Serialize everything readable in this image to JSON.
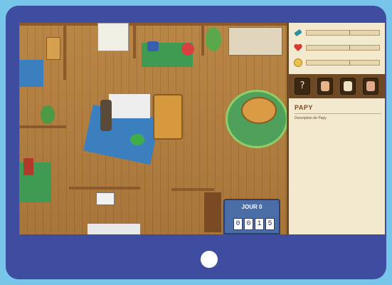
{
  "stats": [
    {
      "icon": "bandage-icon",
      "level": 0.0
    },
    {
      "icon": "heart-icon",
      "level": 0.0
    },
    {
      "icon": "coin-icon",
      "level": 0.0
    }
  ],
  "tabs": [
    {
      "name": "tab-help",
      "label": "?"
    },
    {
      "name": "tab-character-papy",
      "label": ""
    },
    {
      "name": "tab-item-1",
      "label": ""
    },
    {
      "name": "tab-item-2",
      "label": ""
    }
  ],
  "info": {
    "name": "PAPY",
    "description": "Description de Papy"
  },
  "day": {
    "label": "JOUR 0",
    "digits": [
      "0",
      "0",
      "1",
      "5"
    ]
  },
  "colors": {
    "background": "#78c5ea",
    "tablet": "#3f4da0",
    "floor": "#b88447",
    "panel": "#f3e9cf",
    "day_box": "#4a6da8"
  }
}
